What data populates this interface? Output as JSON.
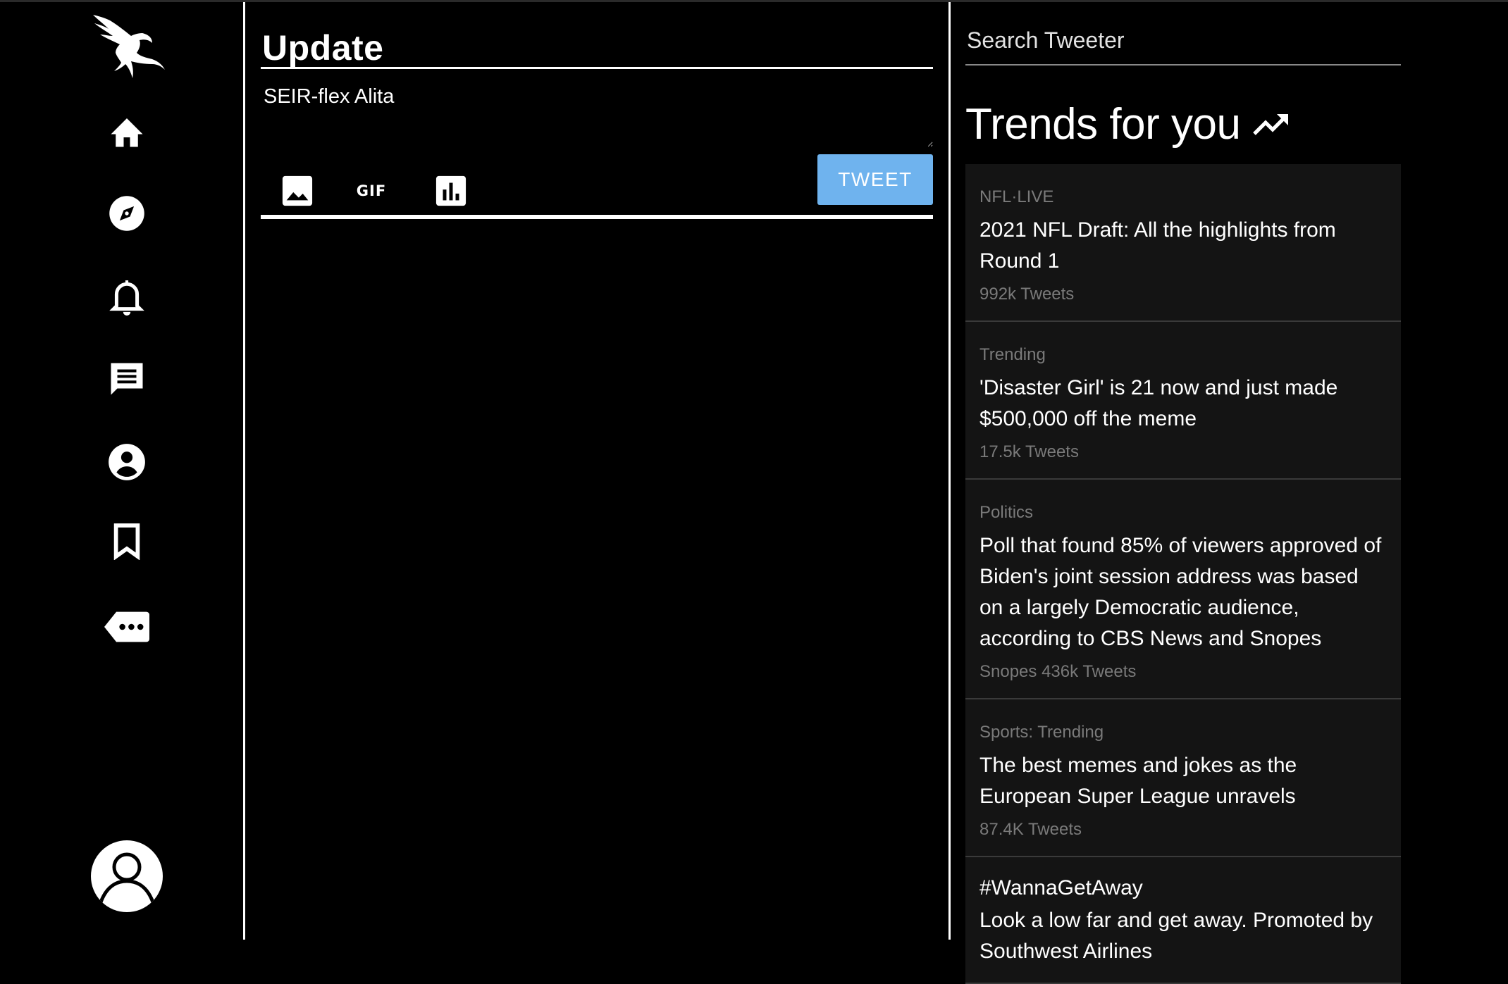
{
  "compose": {
    "title": "Update",
    "draft_text": "SEIR-flex Alita",
    "tweet_label": "TWEET",
    "gif_label": "GIF"
  },
  "search": {
    "placeholder": "Search Tweeter"
  },
  "trends": {
    "title": "Trends for you",
    "items": [
      {
        "category": "NFL·LIVE",
        "headline": "2021 NFL Draft: All the highlights from Round 1",
        "count": "992k Tweets"
      },
      {
        "category": "Trending",
        "headline": "'Disaster Girl' is 21 now and just made $500,000 off the meme",
        "count": "17.5k Tweets"
      },
      {
        "category": "Politics",
        "headline": "Poll that found 85% of viewers approved of Biden's joint session address was based on a largely Democratic audience, according to CBS News and Snopes",
        "count": "Snopes 436k Tweets"
      },
      {
        "category": "Sports: Trending",
        "headline": "The best memes and jokes as the European Super League unravels",
        "count": "87.4K Tweets"
      },
      {
        "category": "#WannaGetAway",
        "headline": "Look a low far and get away. Promoted by Southwest Airlines"
      }
    ]
  },
  "nav": {
    "icons": [
      "eagle-logo-icon",
      "home-icon",
      "explore-icon",
      "notifications-icon",
      "messages-icon",
      "profile-icon",
      "bookmarks-icon",
      "more-icon",
      "user-avatar-icon"
    ]
  },
  "colors": {
    "background": "#000000",
    "tweet_button": "#6fb3ee",
    "trend_card": "#141414",
    "muted_text": "#7a7a7a"
  }
}
